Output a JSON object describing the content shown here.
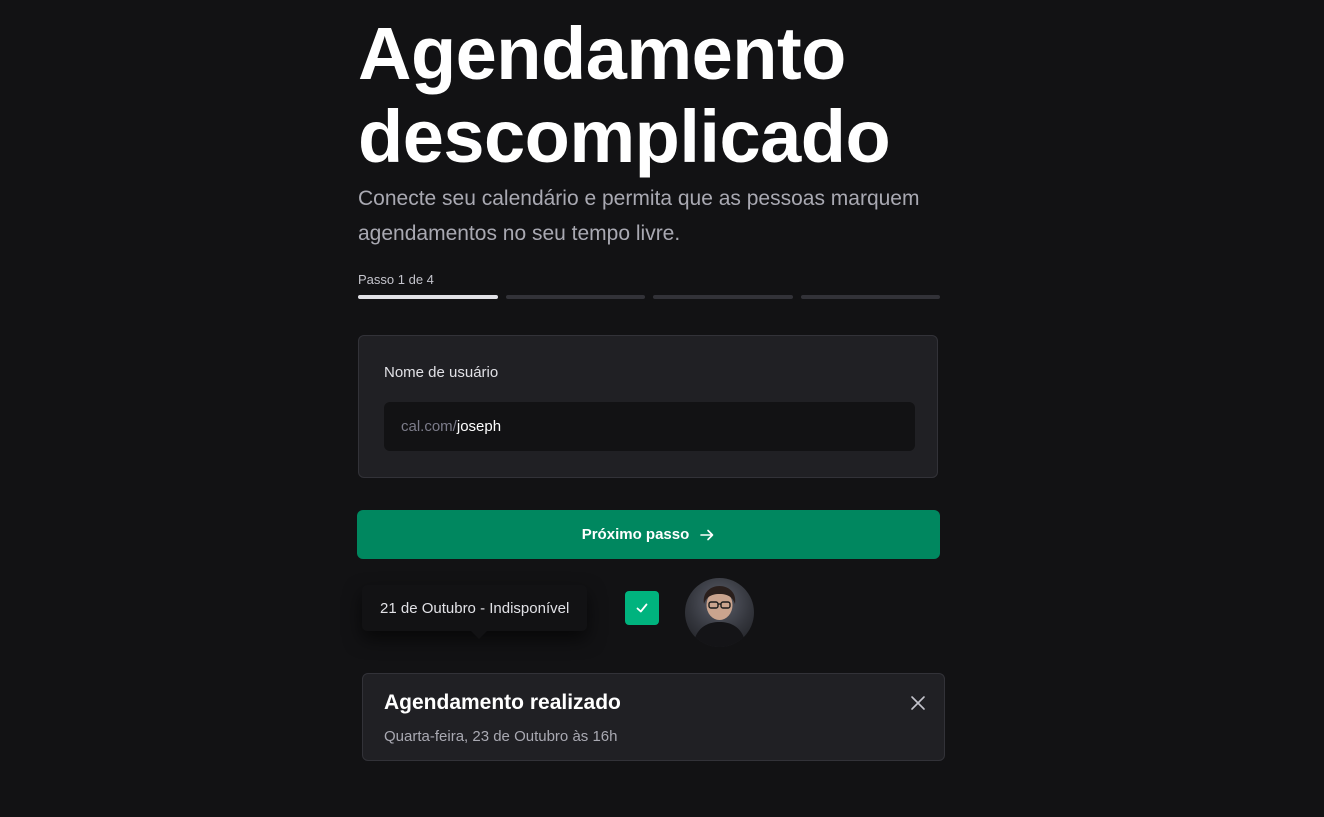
{
  "hero": {
    "title": "Agendamento descomplicado",
    "subtitle": "Conecte seu calendário e permita que as pessoas marquem agendamentos no seu tempo livre."
  },
  "steps": {
    "label": "Passo 1 de 4",
    "current": 1,
    "total": 4
  },
  "form": {
    "username_label": "Nome de usuário",
    "username_prefix": "cal.com/",
    "username_value": "joseph"
  },
  "next_button": {
    "label": "Próximo passo",
    "icon": "arrow-right-icon"
  },
  "preview": {
    "tooltip_text": "21 de Outubro - Indisponível",
    "checkbox_icon": "check-icon",
    "checkbox_checked": true,
    "avatar_icon": "user-avatar"
  },
  "toast": {
    "title": "Agendamento realizado",
    "description": "Quarta-feira, 23 de Outubro às 16h",
    "close_icon": "close-icon"
  },
  "colors": {
    "background": "#121214",
    "card": "#202024",
    "accent": "#00875f",
    "checkbox": "#00b37e",
    "text": "#ffffff",
    "muted": "#a9a9b2"
  }
}
